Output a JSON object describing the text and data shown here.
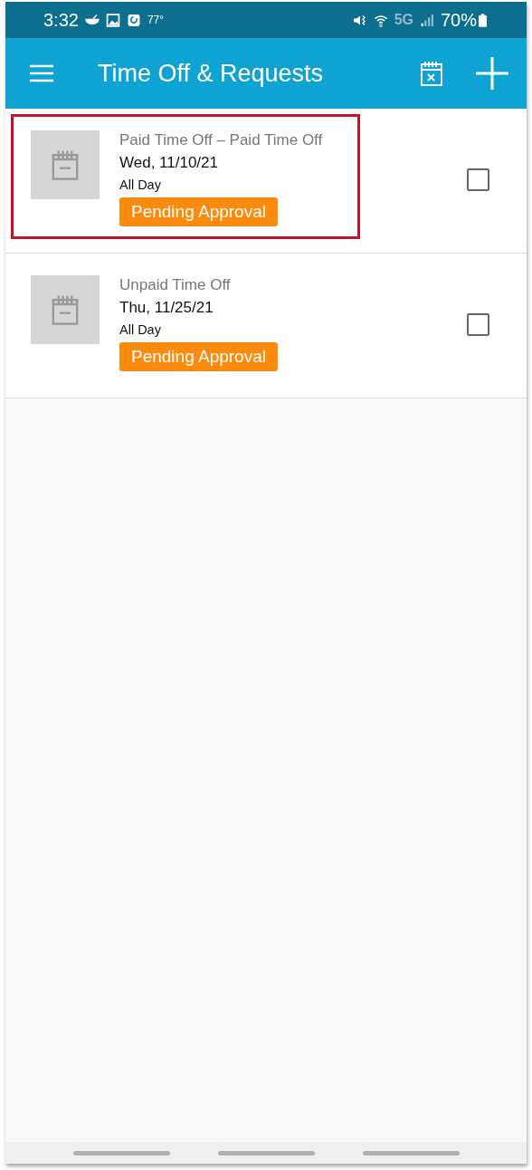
{
  "status_bar": {
    "time": "3:32",
    "temperature": "77°",
    "network": "5G",
    "battery": "70%"
  },
  "app_bar": {
    "title": "Time Off & Requests"
  },
  "requests": [
    {
      "type": "Paid Time Off – Paid Time Off",
      "date": "Wed, 11/10/21",
      "duration": "All Day",
      "status": "Pending Approval",
      "checked": false,
      "highlighted": true
    },
    {
      "type": "Unpaid Time Off",
      "date": "Thu, 11/25/21",
      "duration": "All Day",
      "status": "Pending Approval",
      "checked": false,
      "highlighted": false
    }
  ]
}
